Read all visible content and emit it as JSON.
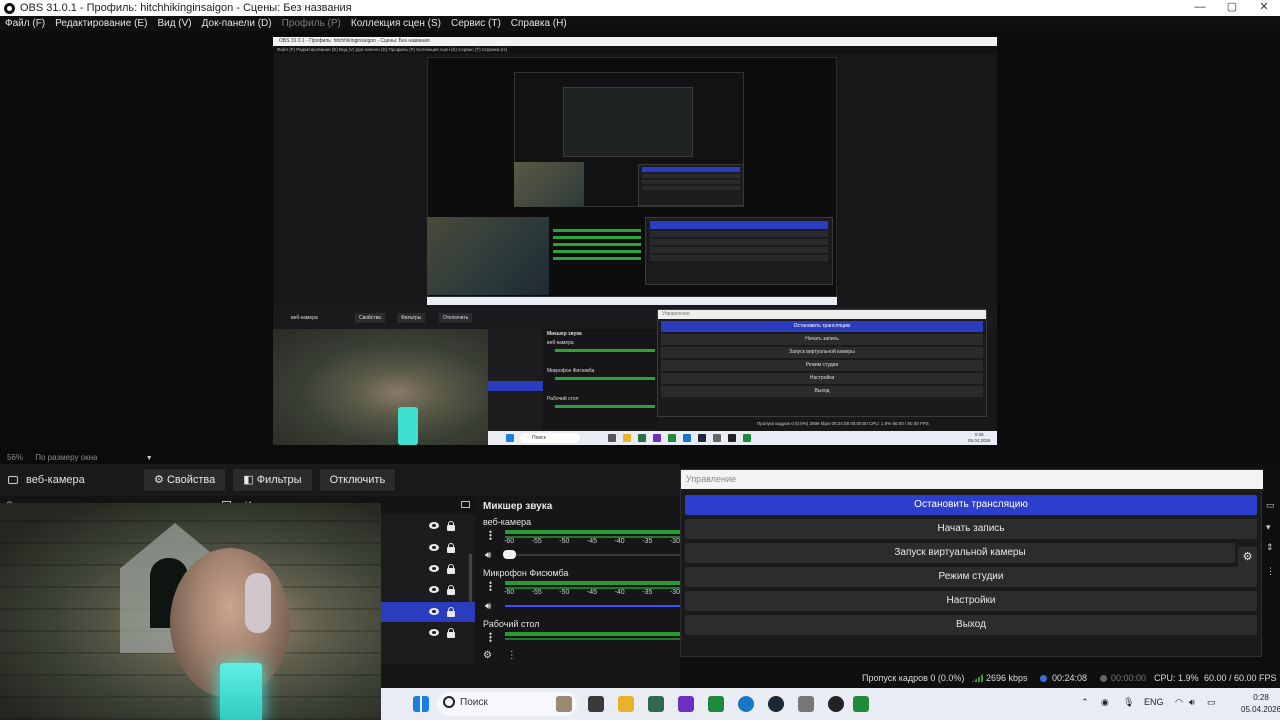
{
  "window": {
    "title": "OBS 31.0.1 - Профиль: hitchhikinginsaigon - Сцены: Без названия",
    "controls": [
      "—",
      "▢",
      "✕"
    ]
  },
  "menu": [
    {
      "label": "Файл (F)",
      "disabled": false
    },
    {
      "label": "Редактирование (E)",
      "disabled": false
    },
    {
      "label": "Вид (V)",
      "disabled": false
    },
    {
      "label": "Док-панели (D)",
      "disabled": false
    },
    {
      "label": "Профиль (P)",
      "disabled": true
    },
    {
      "label": "Коллекция сцен (S)",
      "disabled": false
    },
    {
      "label": "Сервис (T)",
      "disabled": false
    },
    {
      "label": "Справка (H)",
      "disabled": false
    }
  ],
  "preview_nested": {
    "title": "OBS 31.0.1 - Профиль: hitchhikinginsaigon - Сцены: Без названия",
    "menu": "Файл (F)   Редактирование (E)   Вид (V)   Док-панели (D)   Профиль (P)   Коллекция сцен (S)   Сервис (T)   Справка (H)",
    "zoom": "56%   По размеру окна",
    "source": "веб-камера",
    "properties": "Свойства",
    "filters": "Фильтры",
    "disable": "Отключить",
    "mixer_title": "Микшер звука",
    "ch1": "веб-камера",
    "ch2": "Микрофон Фисюмба",
    "ch3": "Рабочий стол",
    "control_header": "Управление",
    "buttons": [
      "Остановить трансляцию",
      "Начать запись",
      "Запуск виртуальной камеры",
      "Режим студии",
      "Настройки",
      "Выход"
    ],
    "status": "Пропуск кадров 0 (0.0%)   2696 kbps   00:24:08   00:00:00   CPU: 1.9%   60.00 / 60.00 FPS",
    "taskbar_search": "Поиск",
    "clock_time": "0:28",
    "clock_date": "05.04.2026"
  },
  "zoombar": {
    "percent": "56%",
    "mode": "По размеру окна"
  },
  "source_toolbar": {
    "source_name": "веб-камера",
    "properties_label": "Свойства",
    "filters_label": "Фильтры",
    "disable_label": "Отключить"
  },
  "docks": {
    "scenes_header": "Сцены",
    "sources_header": "Источники"
  },
  "sources": [
    {
      "visible": true,
      "locked": true,
      "selected": false
    },
    {
      "visible": true,
      "locked": true,
      "selected": false
    },
    {
      "visible": true,
      "locked": true,
      "selected": false
    },
    {
      "visible": true,
      "locked": true,
      "selected": false
    },
    {
      "visible": true,
      "locked": true,
      "selected": true
    },
    {
      "visible": true,
      "locked": true,
      "selected": false
    }
  ],
  "mixer": {
    "title": "Микшер звука",
    "scale": [
      "-60",
      "-55",
      "-50",
      "-45",
      "-40",
      "-35",
      "-30"
    ],
    "channels": [
      {
        "name": "веб-камера",
        "volume_fraction": 0.05
      },
      {
        "name": "Микрофон Фисюмба",
        "volume_fraction": 1.0
      },
      {
        "name": "Рабочий стол",
        "volume_fraction": 1.0
      }
    ]
  },
  "control": {
    "header": "Управление",
    "buttons": [
      {
        "label": "Остановить трансляцию",
        "primary": true
      },
      {
        "label": "Начать запись",
        "primary": false
      },
      {
        "label": "Запуск виртуальной камеры",
        "primary": false
      },
      {
        "label": "Режим студии",
        "primary": false
      },
      {
        "label": "Настройки",
        "primary": false
      },
      {
        "label": "Выход",
        "primary": false
      }
    ]
  },
  "status": {
    "dropped": "Пропуск кадров 0 (0.0%)",
    "bitrate": "2696 kbps",
    "stream_time": "00:24:08",
    "rec_time": "00:00:00",
    "cpu": "CPU: 1.9%",
    "fps": "60.00 / 60.00 FPS"
  },
  "taskbar": {
    "search_placeholder": "Поиск",
    "language": "ENG",
    "time": "0:28",
    "date": "05.04.2026"
  },
  "colors": {
    "accent": "#2b3fcc",
    "meter_green": "#2a9a32",
    "record_red": "#d33"
  }
}
